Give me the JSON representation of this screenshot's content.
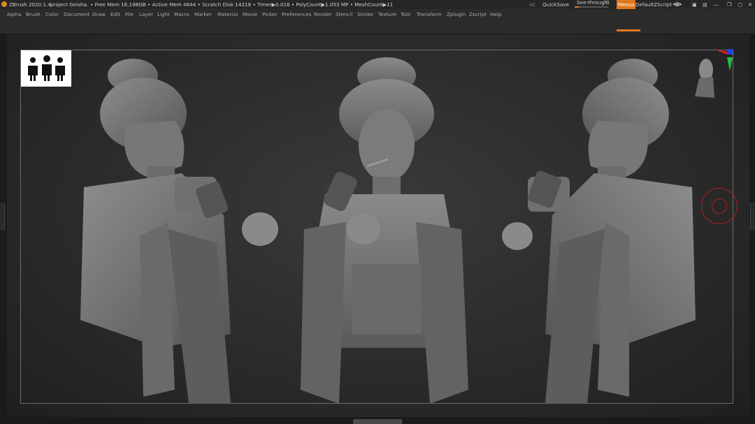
{
  "titlebar": {
    "app": "ZBrush 2020.1.4",
    "project": "project Geisha",
    "stats": "... • Free Mem 16.198GB • Active Mem 4644 • Scratch Disk 14218 • Timer▶0.016 • PolyCount▶1.053 MP • MeshCount▶11",
    "ac": "AC",
    "quicksave": "QuickSave",
    "see_through": "See-through",
    "see_through_value": "0",
    "see_through_level": 0,
    "menus": "Menus",
    "script": "DefaultZScript"
  },
  "menubar": {
    "items": [
      "Alpha",
      "Brush",
      "Color",
      "Document",
      "Draw",
      "Edit",
      "File",
      "Layer",
      "Light",
      "Macro",
      "Marker",
      "Material",
      "Movie",
      "Picker",
      "Preferences",
      "Render",
      "Stencil",
      "Stroke",
      "Texture",
      "Tool",
      "Transform",
      "Zplugin",
      "Zscript",
      "Help"
    ]
  },
  "colors": {
    "accent": "#e0781e",
    "canvas": "#2b2b2b",
    "clay": "#7a7a7a",
    "cursor": "#b12020"
  },
  "icons": {
    "app": "zbrush-logo-icon",
    "window": [
      "layout-icon",
      "collapse-icon",
      "restore-icon",
      "close-icon"
    ],
    "orientation": "head-orientation-icon",
    "brush": "brush-cursor-icon"
  }
}
